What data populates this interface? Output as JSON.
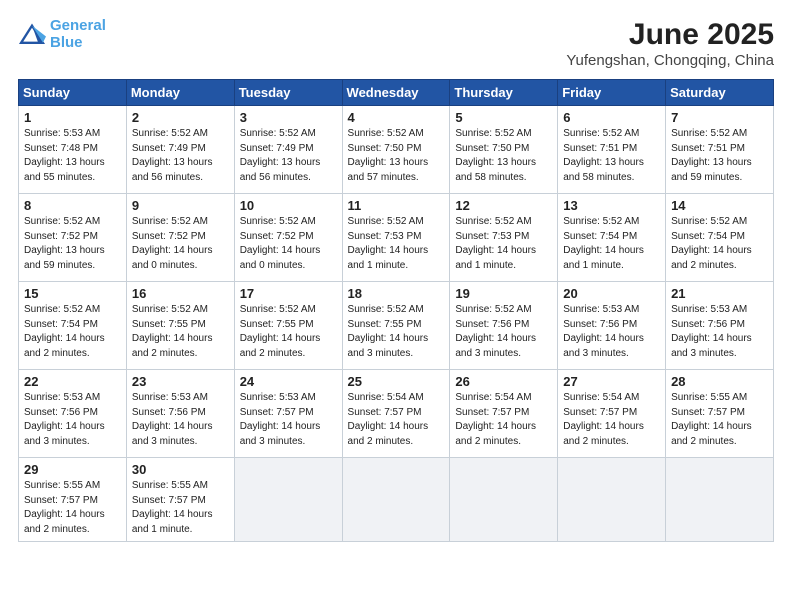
{
  "header": {
    "logo_line1": "General",
    "logo_line2": "Blue",
    "month": "June 2025",
    "location": "Yufengshan, Chongqing, China"
  },
  "weekdays": [
    "Sunday",
    "Monday",
    "Tuesday",
    "Wednesday",
    "Thursday",
    "Friday",
    "Saturday"
  ],
  "weeks": [
    [
      {
        "day": 1,
        "info": "Sunrise: 5:53 AM\nSunset: 7:48 PM\nDaylight: 13 hours\nand 55 minutes."
      },
      {
        "day": 2,
        "info": "Sunrise: 5:52 AM\nSunset: 7:49 PM\nDaylight: 13 hours\nand 56 minutes."
      },
      {
        "day": 3,
        "info": "Sunrise: 5:52 AM\nSunset: 7:49 PM\nDaylight: 13 hours\nand 56 minutes."
      },
      {
        "day": 4,
        "info": "Sunrise: 5:52 AM\nSunset: 7:50 PM\nDaylight: 13 hours\nand 57 minutes."
      },
      {
        "day": 5,
        "info": "Sunrise: 5:52 AM\nSunset: 7:50 PM\nDaylight: 13 hours\nand 58 minutes."
      },
      {
        "day": 6,
        "info": "Sunrise: 5:52 AM\nSunset: 7:51 PM\nDaylight: 13 hours\nand 58 minutes."
      },
      {
        "day": 7,
        "info": "Sunrise: 5:52 AM\nSunset: 7:51 PM\nDaylight: 13 hours\nand 59 minutes."
      }
    ],
    [
      {
        "day": 8,
        "info": "Sunrise: 5:52 AM\nSunset: 7:52 PM\nDaylight: 13 hours\nand 59 minutes."
      },
      {
        "day": 9,
        "info": "Sunrise: 5:52 AM\nSunset: 7:52 PM\nDaylight: 14 hours\nand 0 minutes."
      },
      {
        "day": 10,
        "info": "Sunrise: 5:52 AM\nSunset: 7:52 PM\nDaylight: 14 hours\nand 0 minutes."
      },
      {
        "day": 11,
        "info": "Sunrise: 5:52 AM\nSunset: 7:53 PM\nDaylight: 14 hours\nand 1 minute."
      },
      {
        "day": 12,
        "info": "Sunrise: 5:52 AM\nSunset: 7:53 PM\nDaylight: 14 hours\nand 1 minute."
      },
      {
        "day": 13,
        "info": "Sunrise: 5:52 AM\nSunset: 7:54 PM\nDaylight: 14 hours\nand 1 minute."
      },
      {
        "day": 14,
        "info": "Sunrise: 5:52 AM\nSunset: 7:54 PM\nDaylight: 14 hours\nand 2 minutes."
      }
    ],
    [
      {
        "day": 15,
        "info": "Sunrise: 5:52 AM\nSunset: 7:54 PM\nDaylight: 14 hours\nand 2 minutes."
      },
      {
        "day": 16,
        "info": "Sunrise: 5:52 AM\nSunset: 7:55 PM\nDaylight: 14 hours\nand 2 minutes."
      },
      {
        "day": 17,
        "info": "Sunrise: 5:52 AM\nSunset: 7:55 PM\nDaylight: 14 hours\nand 2 minutes."
      },
      {
        "day": 18,
        "info": "Sunrise: 5:52 AM\nSunset: 7:55 PM\nDaylight: 14 hours\nand 3 minutes."
      },
      {
        "day": 19,
        "info": "Sunrise: 5:52 AM\nSunset: 7:56 PM\nDaylight: 14 hours\nand 3 minutes."
      },
      {
        "day": 20,
        "info": "Sunrise: 5:53 AM\nSunset: 7:56 PM\nDaylight: 14 hours\nand 3 minutes."
      },
      {
        "day": 21,
        "info": "Sunrise: 5:53 AM\nSunset: 7:56 PM\nDaylight: 14 hours\nand 3 minutes."
      }
    ],
    [
      {
        "day": 22,
        "info": "Sunrise: 5:53 AM\nSunset: 7:56 PM\nDaylight: 14 hours\nand 3 minutes."
      },
      {
        "day": 23,
        "info": "Sunrise: 5:53 AM\nSunset: 7:56 PM\nDaylight: 14 hours\nand 3 minutes."
      },
      {
        "day": 24,
        "info": "Sunrise: 5:53 AM\nSunset: 7:57 PM\nDaylight: 14 hours\nand 3 minutes."
      },
      {
        "day": 25,
        "info": "Sunrise: 5:54 AM\nSunset: 7:57 PM\nDaylight: 14 hours\nand 2 minutes."
      },
      {
        "day": 26,
        "info": "Sunrise: 5:54 AM\nSunset: 7:57 PM\nDaylight: 14 hours\nand 2 minutes."
      },
      {
        "day": 27,
        "info": "Sunrise: 5:54 AM\nSunset: 7:57 PM\nDaylight: 14 hours\nand 2 minutes."
      },
      {
        "day": 28,
        "info": "Sunrise: 5:55 AM\nSunset: 7:57 PM\nDaylight: 14 hours\nand 2 minutes."
      }
    ],
    [
      {
        "day": 29,
        "info": "Sunrise: 5:55 AM\nSunset: 7:57 PM\nDaylight: 14 hours\nand 2 minutes."
      },
      {
        "day": 30,
        "info": "Sunrise: 5:55 AM\nSunset: 7:57 PM\nDaylight: 14 hours\nand 1 minute."
      },
      null,
      null,
      null,
      null,
      null
    ]
  ]
}
